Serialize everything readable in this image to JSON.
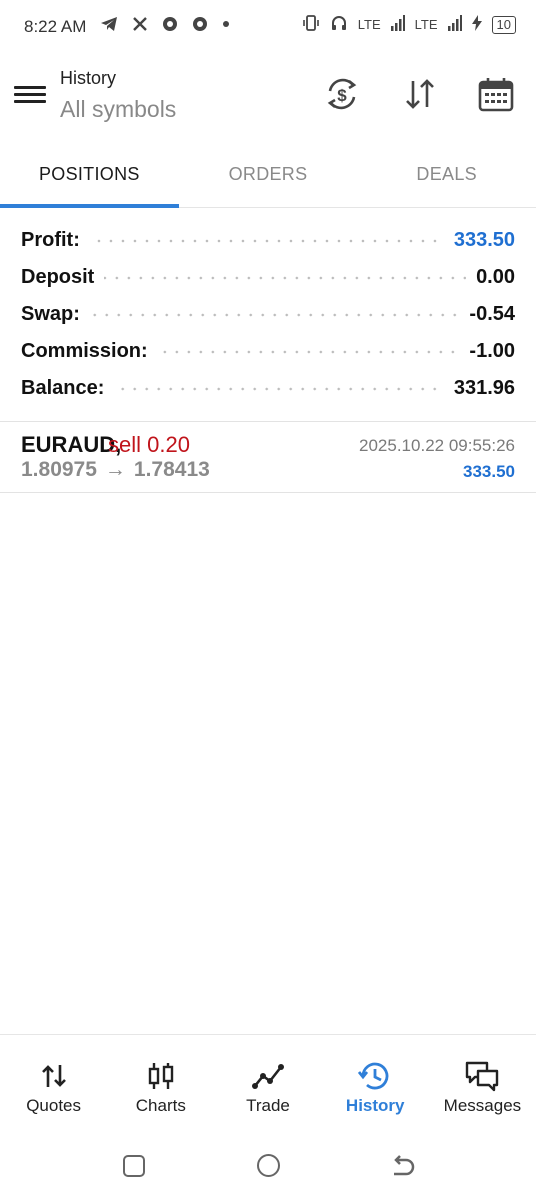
{
  "status_bar": {
    "time": "8:22 AM",
    "left_icons": [
      "telegram-icon",
      "x-icon",
      "chrome-icon",
      "chrome-icon",
      "dot-icon"
    ],
    "right_icons": [
      "vibrate-icon",
      "headset-icon",
      "lte-signal-icon",
      "lte-signal-icon",
      "charging-icon"
    ],
    "lte1": "LTE",
    "lte2": "LTE",
    "battery": "10"
  },
  "toolbar": {
    "title": "History",
    "subtitle": "All symbols",
    "icons": [
      "currency-exchange-icon",
      "sort-icon",
      "calendar-icon"
    ]
  },
  "tabs": [
    {
      "label": "POSITIONS",
      "active": true
    },
    {
      "label": "ORDERS",
      "active": false
    },
    {
      "label": "DEALS",
      "active": false
    }
  ],
  "summary": [
    {
      "label": "Profit:",
      "value": "333.50",
      "color": "#1f6fd1"
    },
    {
      "label": "Deposit",
      "value": "0.00"
    },
    {
      "label": "Swap:",
      "value": "-0.54"
    },
    {
      "label": "Commission:",
      "value": "-1.00"
    },
    {
      "label": "Balance:",
      "value": "331.96"
    }
  ],
  "positions": [
    {
      "symbol": "EURAUD,",
      "side": "sell 0.20",
      "open_price": "1.80975",
      "arrow": "→",
      "close_price": "1.78413",
      "time": "2025.10.22 09:55:26",
      "profit": "333.50"
    }
  ],
  "bottom_nav": [
    {
      "label": "Quotes",
      "icon": "quotes-icon",
      "active": false
    },
    {
      "label": "Charts",
      "icon": "candlestick-icon",
      "active": false
    },
    {
      "label": "Trade",
      "icon": "trade-line-icon",
      "active": false
    },
    {
      "label": "History",
      "icon": "history-icon",
      "active": true
    },
    {
      "label": "Messages",
      "icon": "messages-icon",
      "active": false
    }
  ],
  "colors": {
    "accent": "#2f7fd8",
    "profit_blue": "#1f6fd1",
    "sell_red": "#c0141b"
  }
}
